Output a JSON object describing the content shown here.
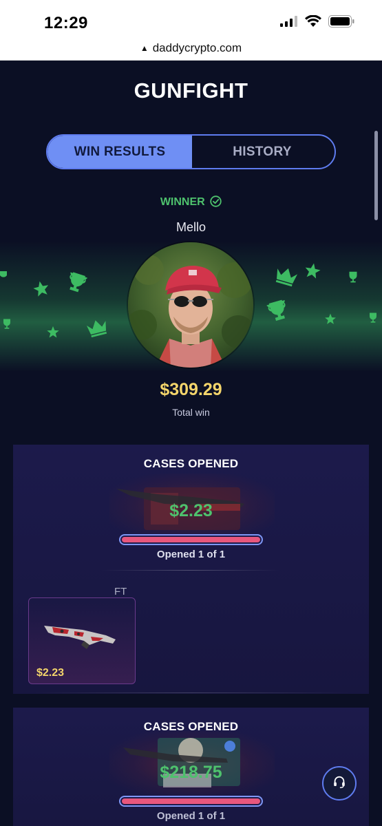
{
  "status": {
    "time": "12:29"
  },
  "browser": {
    "url": "daddycrypto.com"
  },
  "page": {
    "title": "GUNFIGHT",
    "tabs": [
      {
        "label": "WIN RESULTS",
        "active": true
      },
      {
        "label": "HISTORY",
        "active": false
      }
    ],
    "winner_label": "WINNER",
    "winner_name": "Mello",
    "total_amount": "$309.29",
    "total_label": "Total win"
  },
  "cards": [
    {
      "title": "CASES OPENED",
      "case_value": "$2.23",
      "opened_text": "Opened 1 of 1",
      "progress": 1.0,
      "items": [
        {
          "condition": "FT",
          "price": "$2.23"
        }
      ]
    },
    {
      "title": "CASES OPENED",
      "case_value": "$218.75",
      "opened_text": "Opened 1 of 1",
      "progress": 1.0
    }
  ],
  "colors": {
    "accent": "#6f8ff4",
    "win_green": "#4ec26d",
    "gold": "#f4d56b",
    "progress_fill": "#e8577d",
    "background": "#0b0f24"
  },
  "icons": [
    "signal-icon",
    "wifi-icon",
    "battery-icon",
    "lock-icon",
    "check-circle-icon",
    "trophy-icon",
    "crown-icon",
    "star-icon",
    "headset-icon"
  ]
}
